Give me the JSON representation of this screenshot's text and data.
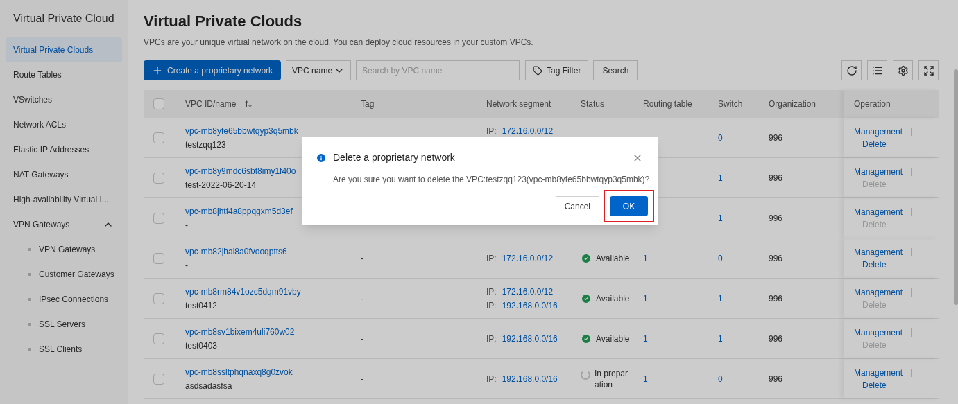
{
  "sidebar": {
    "title": "Virtual Private Cloud",
    "items": [
      {
        "label": "Virtual Private Clouds",
        "selected": true
      },
      {
        "label": "Route Tables",
        "selected": false
      },
      {
        "label": "VSwitches",
        "selected": false
      },
      {
        "label": "Network ACLs",
        "selected": false
      },
      {
        "label": "Elastic IP Addresses",
        "selected": false
      },
      {
        "label": "NAT Gateways",
        "selected": false
      },
      {
        "label": "High-availability Virtual I...",
        "selected": false
      },
      {
        "label": "VPN Gateways",
        "selected": false,
        "expanded": true,
        "children": [
          {
            "label": "VPN Gateways",
            "selected": false
          },
          {
            "label": "Customer Gateways",
            "selected": false
          },
          {
            "label": "IPsec Connections",
            "selected": false
          },
          {
            "label": "SSL Servers",
            "selected": false
          },
          {
            "label": "SSL Clients",
            "selected": false
          }
        ]
      }
    ]
  },
  "page": {
    "title": "Virtual Private Clouds",
    "description": "VPCs are your unique virtual network on the cloud. You can deploy cloud resources in your custom VPCs."
  },
  "toolbar": {
    "create_button": "Create a proprietary network",
    "filter_select": "VPC name",
    "search_placeholder": "Search by VPC name",
    "tag_filter": "Tag Filter",
    "search_button": "Search"
  },
  "table": {
    "header_checked": false,
    "columns": [
      "VPC ID/name",
      "Tag",
      "Network segment",
      "Status",
      "Routing table",
      "Switch",
      "Organization",
      "Operation"
    ],
    "rows": [
      {
        "checked": false,
        "id": "vpc-mb8yfe65bbwtqyp3q5mbk",
        "name": "testzqq123",
        "segments": [
          {
            "label": "IP:",
            "value": "172.16.0.0/12"
          }
        ],
        "switch": "0",
        "organization": "996",
        "operations": [
          {
            "label": "Management",
            "disabled": false
          },
          {
            "label": "Delete",
            "disabled": false
          }
        ]
      },
      {
        "checked": false,
        "id": "vpc-mb8y9mdc6sbt8imy1f40o",
        "name": "test-2022-06-20-14",
        "switch": "1",
        "organization": "996",
        "operations": [
          {
            "label": "Management",
            "disabled": false
          },
          {
            "label": "Delete",
            "disabled": true
          }
        ]
      },
      {
        "checked": false,
        "id": "vpc-mb8jhtf4a8ppqgxm5d3ef",
        "name": "-",
        "switch": "1",
        "organization": "996",
        "operations": [
          {
            "label": "Management",
            "disabled": false
          },
          {
            "label": "Delete",
            "disabled": true
          }
        ]
      },
      {
        "checked": false,
        "id": "vpc-mb82jhal8a0fvooqptts6",
        "name": "-",
        "tag": "-",
        "segments": [
          {
            "label": "IP:",
            "value": "172.16.0.0/12"
          }
        ],
        "status": {
          "kind": "available",
          "text": "Available"
        },
        "routing": "1",
        "switch": "0",
        "organization": "996",
        "operations": [
          {
            "label": "Management",
            "disabled": false
          },
          {
            "label": "Delete",
            "disabled": false
          }
        ]
      },
      {
        "checked": false,
        "id": "vpc-mb8rm84v1ozc5dqm91vby",
        "name": "test0412",
        "tag": "-",
        "segments": [
          {
            "label": "IP:",
            "value": "172.16.0.0/12"
          },
          {
            "label": "IP:",
            "value": "192.168.0.0/16"
          }
        ],
        "status": {
          "kind": "available",
          "text": "Available"
        },
        "routing": "1",
        "switch": "1",
        "organization": "996",
        "operations": [
          {
            "label": "Management",
            "disabled": false
          },
          {
            "label": "Delete",
            "disabled": true
          }
        ]
      },
      {
        "checked": false,
        "id": "vpc-mb8sv1bixem4uli760w02",
        "name": "test0403",
        "tag": "-",
        "segments": [
          {
            "label": "IP:",
            "value": "192.168.0.0/16"
          }
        ],
        "status": {
          "kind": "available",
          "text": "Available"
        },
        "routing": "1",
        "switch": "1",
        "organization": "996",
        "operations": [
          {
            "label": "Management",
            "disabled": false
          },
          {
            "label": "Delete",
            "disabled": true
          }
        ]
      },
      {
        "checked": false,
        "id": "vpc-mb8ssltphqnaxq8g0zvok",
        "name": "asdsadasfsa",
        "tag": "-",
        "segments": [
          {
            "label": "IP:",
            "value": "192.168.0.0/16"
          }
        ],
        "status": {
          "kind": "pending",
          "text": "In preparation"
        },
        "routing": "1",
        "switch": "0",
        "organization": "996",
        "operations": [
          {
            "label": "Management",
            "disabled": false
          },
          {
            "label": "Delete",
            "disabled": false
          }
        ]
      }
    ]
  },
  "dialog": {
    "title": "Delete a proprietary network",
    "message": "Are you sure you want to delete the VPC:testzqq123(vpc-mb8yfe65bbwtqyp3q5mbk)?",
    "cancel": "Cancel",
    "ok": "OK",
    "ok_highlighted": true
  }
}
